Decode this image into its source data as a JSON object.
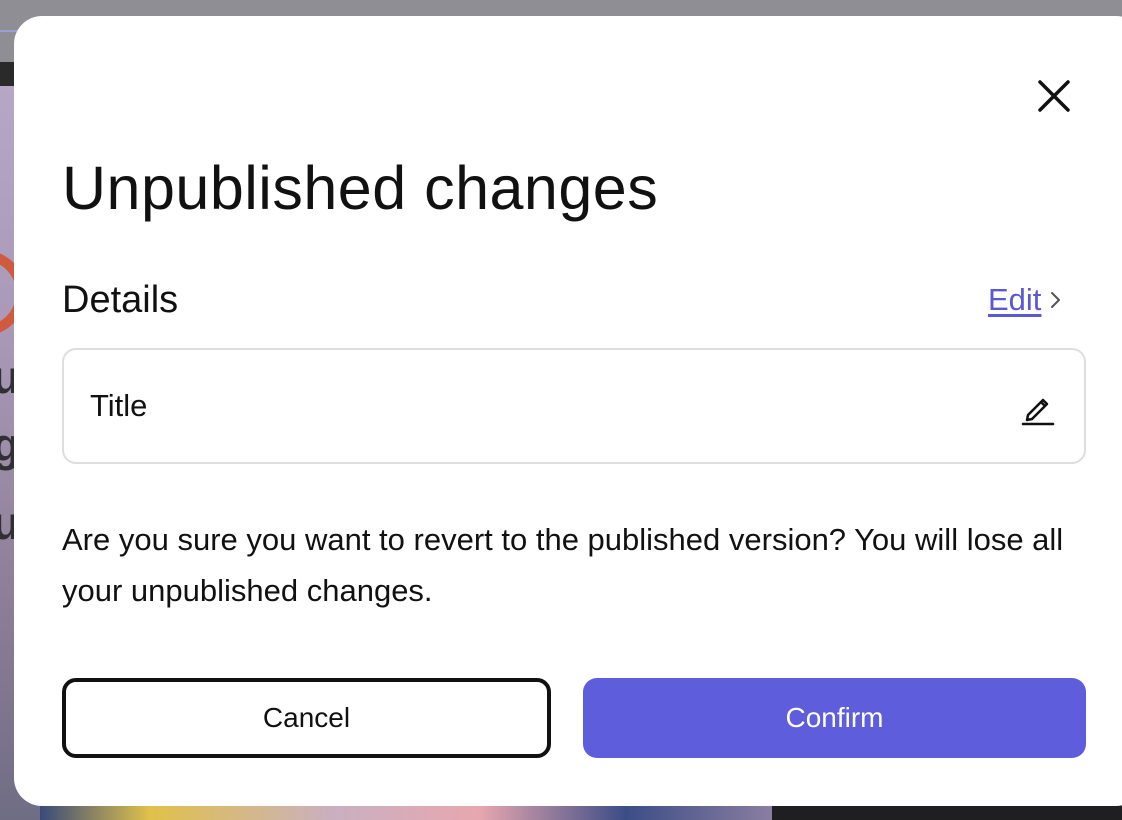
{
  "modal": {
    "title": "Unpublished changes",
    "details_heading": "Details",
    "edit_link_label": "Edit",
    "field_label": "Title",
    "message": "Are you sure you want to revert to the published version? You will lose all your unpublished changes.",
    "cancel_label": "Cancel",
    "confirm_label": "Confirm"
  },
  "colors": {
    "accent": "#5e5ddc",
    "link": "#5b58d6",
    "text": "#111111",
    "field_border": "#dedede"
  },
  "icons": {
    "close": "close-icon",
    "edit_chevron": "chevron-right-icon",
    "field_edit": "pencil-icon"
  }
}
